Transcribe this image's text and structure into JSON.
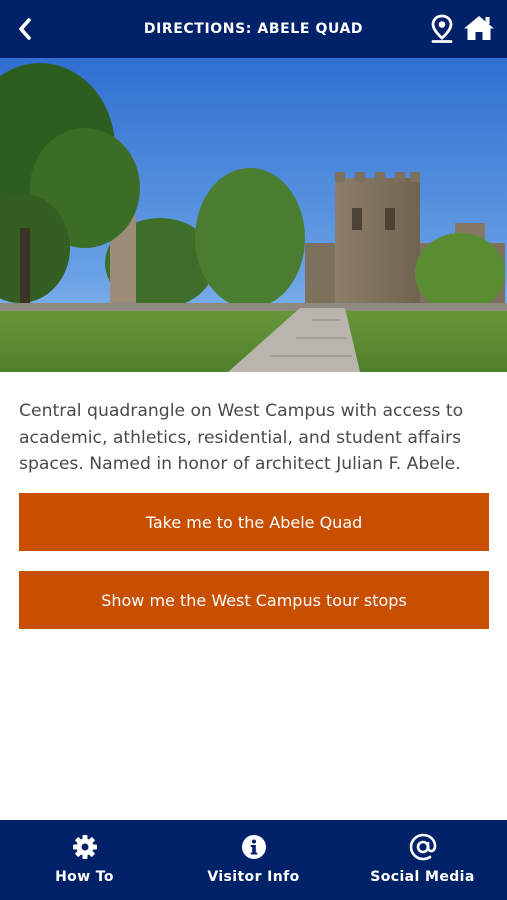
{
  "header": {
    "title": "DIRECTIONS: ABELE QUAD",
    "back_icon": "chevron-left-icon",
    "map_icon": "map-pin-icon",
    "home_icon": "home-icon"
  },
  "photo": {
    "subject": "campus quadrangle photo"
  },
  "content": {
    "description": "Central quadrangle on West Campus with access to academic, athletics, residential, and student affairs spaces. Named in honor of architect Julian F. Abele."
  },
  "actions": {
    "primary_label": "Take me to the Abele Quad",
    "secondary_label": "Show me the West Campus tour stops"
  },
  "bottom_nav": {
    "items": [
      {
        "label": "How To",
        "icon": "gear-icon"
      },
      {
        "label": "Visitor Info",
        "icon": "info-icon"
      },
      {
        "label": "Social Media",
        "icon": "at-icon"
      }
    ]
  },
  "colors": {
    "navy": "#012169",
    "orange": "#c84e00",
    "text": "#4a4a4a"
  }
}
